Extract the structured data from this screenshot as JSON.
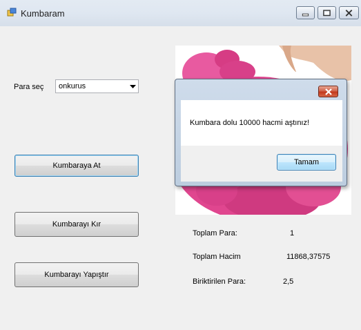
{
  "window": {
    "title": "Kumbaram",
    "app_icon": "form-icon",
    "controls": {
      "minimize_icon": "minimize-icon",
      "maximize_icon": "maximize-icon",
      "close_icon": "close-icon"
    }
  },
  "form": {
    "para_sec_label": "Para seç",
    "coin_select": {
      "value": "onkurus",
      "arrow_icon": "chevron-down-icon"
    },
    "buttons": {
      "kumbaraya_at": "Kumbaraya At",
      "kumbarayi_kir": "Kumbarayı Kır",
      "kumbarayi_yapistir": "Kumbarayı Yapıştır"
    },
    "picture": {
      "subject": "pink piggy bank held by hand"
    },
    "stats": {
      "toplam_para_label": "Toplam Para:",
      "toplam_para_value": "1",
      "toplam_hacim_label": "Toplam Hacim",
      "toplam_hacim_value": "11868,37575",
      "biriktirilen_para_label": "Biriktirilen Para:",
      "biriktirilen_para_value": "2,5"
    }
  },
  "message_box": {
    "text": "Kumbara dolu 10000 hacmi aştınız!",
    "ok_label": "Tamam",
    "close_icon": "close-icon"
  },
  "colors": {
    "piggy_pink": "#e0468f",
    "focus_blue": "#3c7fb1",
    "close_red": "#c2391c"
  }
}
